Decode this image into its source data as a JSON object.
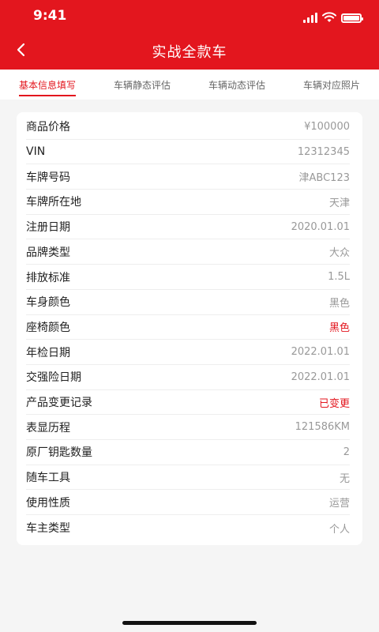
{
  "status_bar": {
    "time": "9:41"
  },
  "header": {
    "title": "实战全款车"
  },
  "tabs": [
    {
      "label": "基本信息填写",
      "active": true
    },
    {
      "label": "车辆静态评估",
      "active": false
    },
    {
      "label": "车辆动态评估",
      "active": false
    },
    {
      "label": "车辆对应照片",
      "active": false
    }
  ],
  "details": [
    {
      "label": "商品价格",
      "value": "¥100000",
      "highlight": false
    },
    {
      "label": "VIN",
      "value": "12312345",
      "highlight": false
    },
    {
      "label": "车牌号码",
      "value": "津ABC123",
      "highlight": false
    },
    {
      "label": "车牌所在地",
      "value": "天津",
      "highlight": false
    },
    {
      "label": "注册日期",
      "value": "2020.01.01",
      "highlight": false
    },
    {
      "label": "品牌类型",
      "value": "大众",
      "highlight": false
    },
    {
      "label": "排放标准",
      "value": "1.5L",
      "highlight": false
    },
    {
      "label": "车身颜色",
      "value": "黑色",
      "highlight": false
    },
    {
      "label": "座椅颜色",
      "value": "黑色",
      "highlight": true
    },
    {
      "label": "年检日期",
      "value": "2022.01.01",
      "highlight": false
    },
    {
      "label": "交强险日期",
      "value": "2022.01.01",
      "highlight": false
    },
    {
      "label": "产品变更记录",
      "value": "已变更",
      "highlight": true
    },
    {
      "label": "表显历程",
      "value": "121586KM",
      "highlight": false
    },
    {
      "label": "原厂钥匙数量",
      "value": "2",
      "highlight": false
    },
    {
      "label": "随车工具",
      "value": "无",
      "highlight": false
    },
    {
      "label": "使用性质",
      "value": "运营",
      "highlight": false
    },
    {
      "label": "车主类型",
      "value": "个人",
      "highlight": false
    }
  ],
  "colors": {
    "brand_red": "#e3161e",
    "value_grey": "#999999"
  },
  "icons": {
    "back": "chevron-left-icon",
    "signal": "cellular-signal-icon",
    "wifi": "wifi-icon",
    "battery": "battery-icon"
  }
}
